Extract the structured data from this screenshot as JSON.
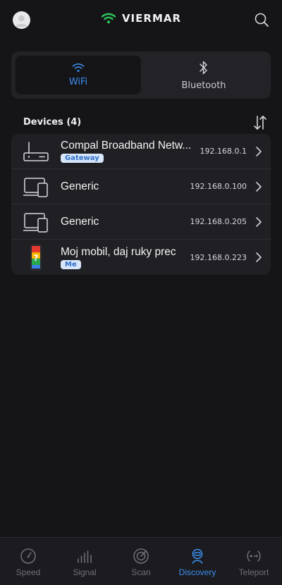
{
  "header": {
    "brand": "VIERMAR",
    "brand_color": "#2fc35a"
  },
  "tabs": [
    {
      "label": "WiFi",
      "icon": "wifi-icon",
      "active": true
    },
    {
      "label": "Bluetooth",
      "icon": "bluetooth-icon",
      "active": false
    }
  ],
  "devices": {
    "title": "Devices (4)",
    "items": [
      {
        "name": "Compal Broadband Netw...",
        "badge": "Gateway",
        "ip": "192.168.0.1",
        "icon": "router-icon"
      },
      {
        "name": "Generic",
        "ip": "192.168.0.100",
        "icon": "devices-icon"
      },
      {
        "name": "Generic",
        "ip": "192.168.0.205",
        "icon": "devices-icon"
      },
      {
        "name": "Moj mobil, daj ruky prec",
        "badge": "Me",
        "ip": "192.168.0.223",
        "icon": "phone-icon"
      }
    ]
  },
  "nav": [
    {
      "label": "Speed",
      "icon": "speedometer-icon"
    },
    {
      "label": "Signal",
      "icon": "signal-bars-icon"
    },
    {
      "label": "Scan",
      "icon": "radar-icon"
    },
    {
      "label": "Discovery",
      "icon": "discovery-icon",
      "active": true
    },
    {
      "label": "Teleport",
      "icon": "teleport-icon"
    }
  ],
  "colors": {
    "accent": "#3c8ef0",
    "badge_bg": "#d7e6fb",
    "background": "#151518"
  }
}
